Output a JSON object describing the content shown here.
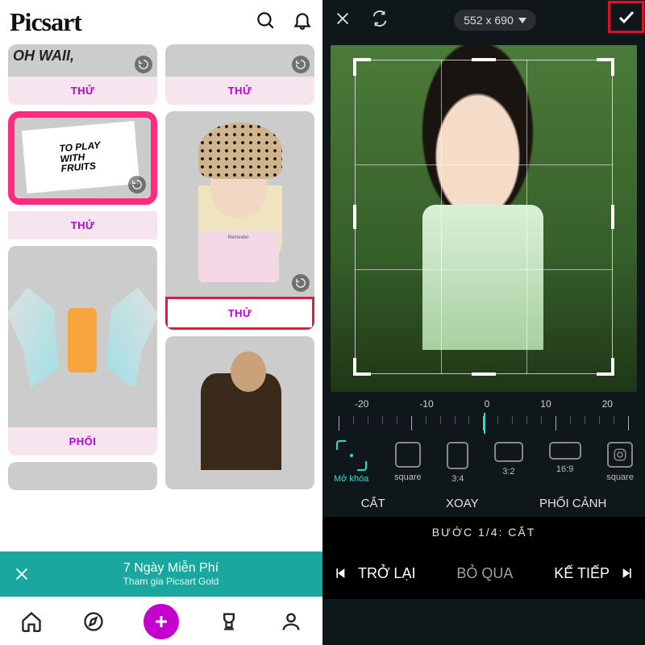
{
  "left": {
    "logo": "Picsart",
    "img1_text": "OH WAII,",
    "fruits_text": "TO PLAY\nWITH\nFRUITS",
    "bucket_note": "Reminder",
    "buttons": {
      "thuA": "THỬ",
      "thuB": "THỬ",
      "thuC": "THỬ",
      "thuD": "THỬ",
      "phoi": "PHỐI"
    },
    "promo": {
      "line1": "7 Ngày Miễn Phí",
      "line2": "Tham gia Picsart Gold"
    }
  },
  "right": {
    "dimensions": "552 x 690",
    "ruler": {
      "n20": "-20",
      "n10": "-10",
      "zero": "0",
      "p10": "10",
      "p20": "20"
    },
    "aspects": {
      "free": "Mở khóa",
      "sq": "square",
      "r34": "3:4",
      "r32": "3:2",
      "r169": "16:9",
      "sq2": "square"
    },
    "tabs": {
      "cut": "CẮT",
      "rotate": "XOAY",
      "persp": "PHỐI CẢNH"
    },
    "step": "BƯỚC 1/4: CẮT",
    "prev": "TRỞ LẠI",
    "skip": "BỎ QUA",
    "next": "KẾ TIẾP"
  }
}
